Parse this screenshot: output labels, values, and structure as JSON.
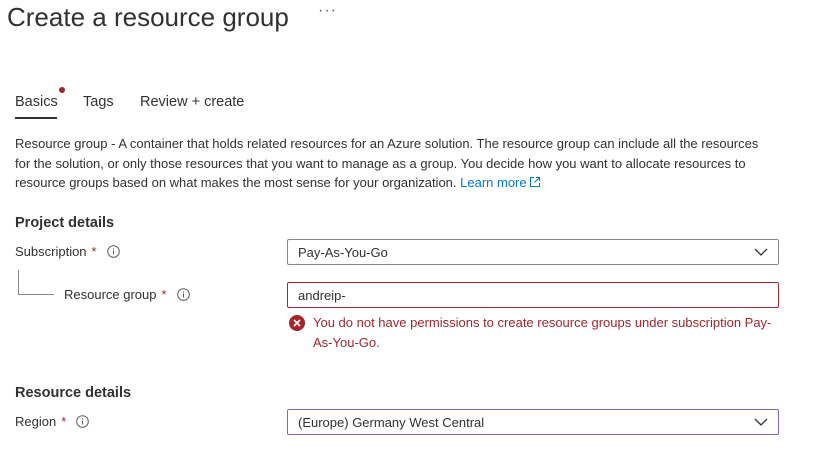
{
  "header": {
    "title": "Create a resource group",
    "more_label": "···"
  },
  "tabs": [
    {
      "label": "Basics",
      "selected": true,
      "has_error": true
    },
    {
      "label": "Tags",
      "selected": false
    },
    {
      "label": "Review + create",
      "selected": false
    }
  ],
  "description": {
    "term": "Resource group",
    "text": " - A container that holds related resources for an Azure solution. The resource group can include all the resources for the solution, or only those resources that you want to manage as a group. You decide how you want to allocate resources to resource groups based on what makes the most sense for your organization. ",
    "link": "Learn more"
  },
  "project_details": {
    "heading": "Project details",
    "subscription": {
      "label": "Subscription",
      "required": "*",
      "value": "Pay-As-You-Go"
    },
    "resource_group": {
      "label": "Resource group",
      "required": "*",
      "value": "andreip-",
      "error": "You do not have permissions to create resource groups under subscription Pay-As-You-Go."
    }
  },
  "resource_details": {
    "heading": "Resource details",
    "region": {
      "label": "Region",
      "required": "*",
      "value": "(Europe) Germany West Central"
    }
  },
  "colors": {
    "accent": "#0078d4",
    "error": "#a4262c",
    "focus": "#8764b8",
    "text": "#323130"
  },
  "icons": {
    "info": "info-icon",
    "error": "error-circle-icon",
    "dropdown": "chevron-down-icon",
    "external": "external-link-icon"
  }
}
